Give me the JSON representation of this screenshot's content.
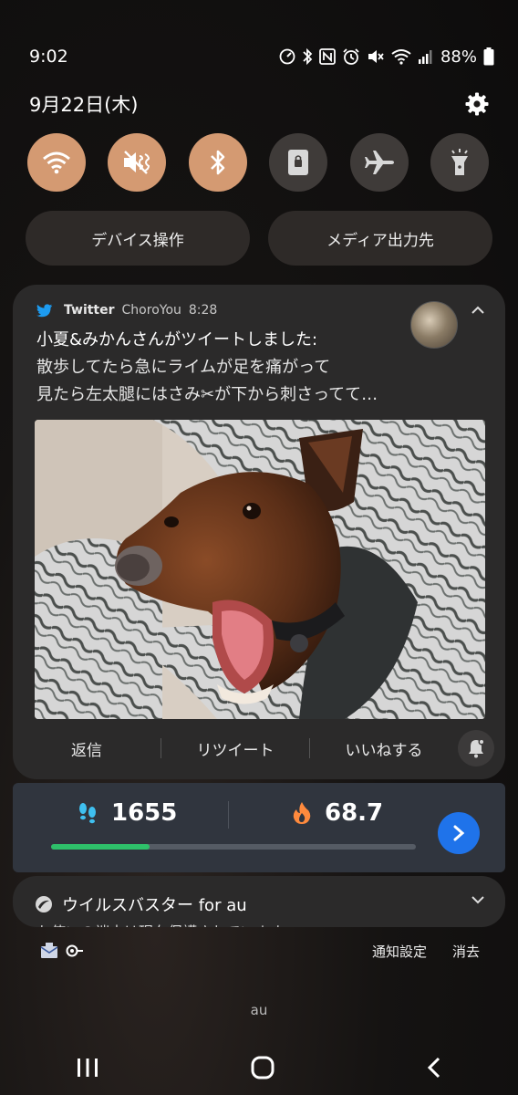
{
  "status_bar": {
    "time": "9:02",
    "battery": "88%",
    "icons": [
      "speedometer-icon",
      "bluetooth-icon",
      "nfc-icon",
      "alarm-icon",
      "mute-icon",
      "wifi-icon",
      "signal-icon",
      "battery-icon"
    ]
  },
  "header": {
    "date": "9月22日(木)",
    "settings_icon": "gear-icon"
  },
  "quick_settings": [
    {
      "name": "wifi",
      "icon": "wifi-icon",
      "state": "on"
    },
    {
      "name": "mute",
      "icon": "mute-icon",
      "state": "on"
    },
    {
      "name": "bluetooth",
      "icon": "bluetooth-icon",
      "state": "on"
    },
    {
      "name": "lock",
      "icon": "lock-icon",
      "state": "off"
    },
    {
      "name": "airplane",
      "icon": "airplane-icon",
      "state": "off"
    },
    {
      "name": "flashlight",
      "icon": "flashlight-icon",
      "state": "off"
    }
  ],
  "pills": {
    "device_control": "デバイス操作",
    "media_output": "メディア出力先"
  },
  "twitter_notification": {
    "app": "Twitter",
    "account": "ChoroYou",
    "time": "8:28",
    "title": "小夏&みかんさんがツイートしました:",
    "body_line1": "散歩してたら急にライムが足を痛がって",
    "body_line2": "見たら左太腿にはさみ✂が下から刺さってて…",
    "actions": {
      "reply": "返信",
      "retweet": "リツイート",
      "like": "いいねする"
    }
  },
  "health_widget": {
    "steps": "1655",
    "calories": "68.7",
    "progress": 0.27
  },
  "virusbuster_notification": {
    "title": "ウイルスバスター for au",
    "body": "お使いの端末は現在保護されています。"
  },
  "footer": {
    "notification_settings": "通知設定",
    "clear": "消去",
    "carrier": "au"
  },
  "colors": {
    "qs_on": "#d49a72",
    "qs_off": "#3f3b39",
    "twitter_blue": "#1d9bf0",
    "step_green": "#2ec06a",
    "go_blue": "#1f73ea"
  }
}
